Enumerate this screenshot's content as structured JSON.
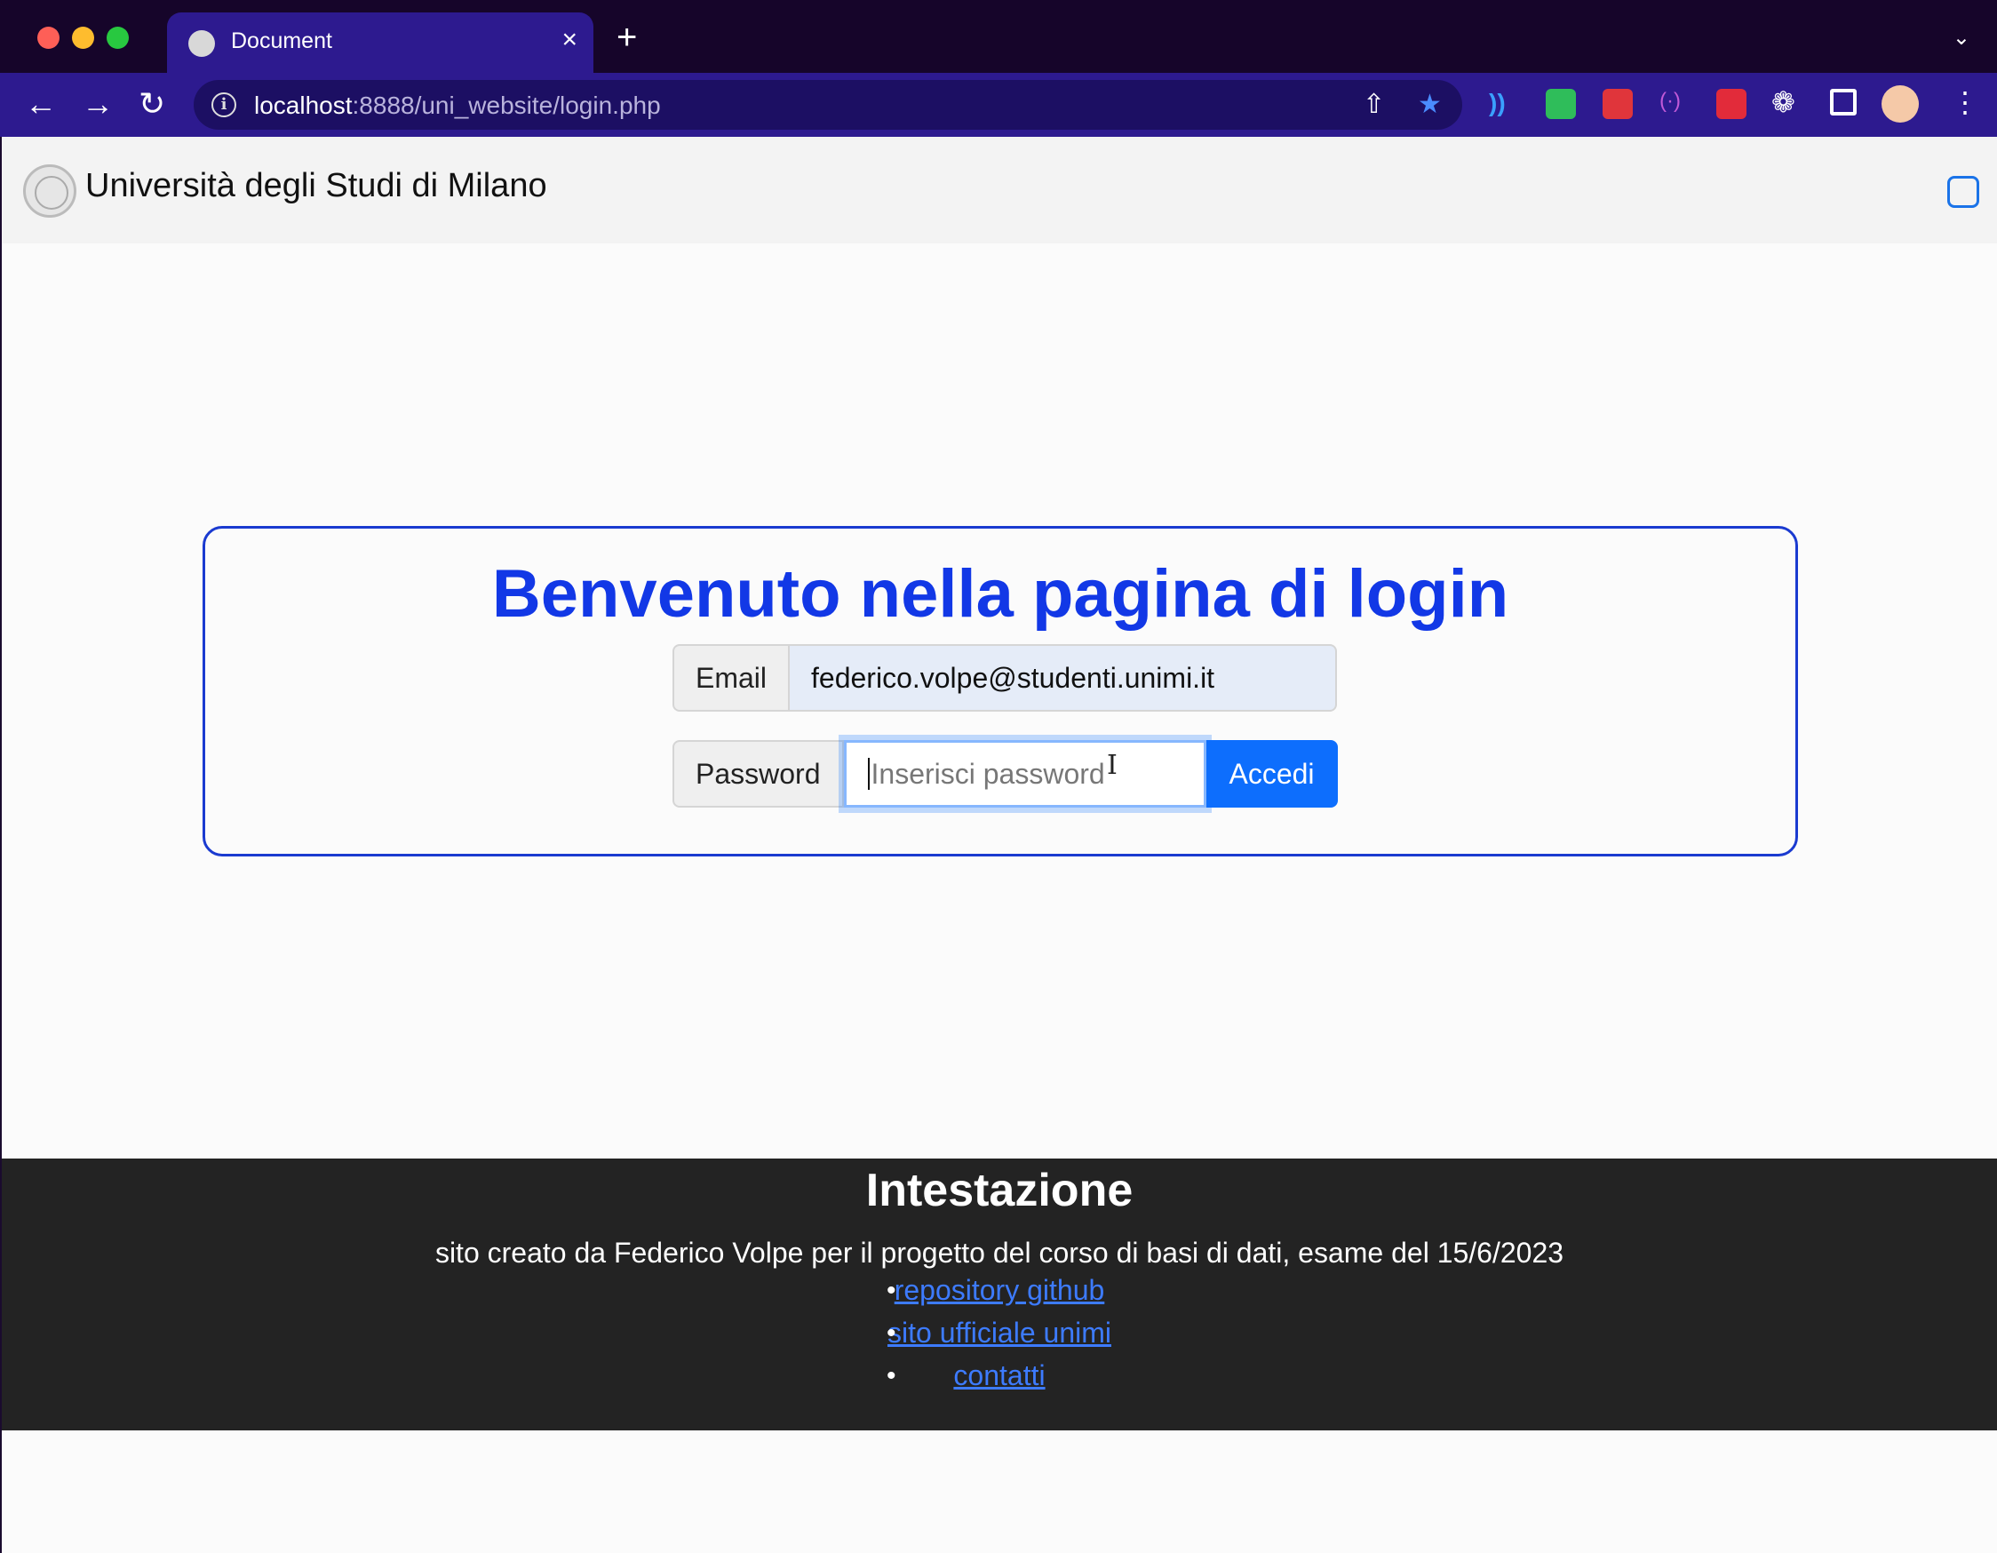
{
  "browser": {
    "tab_title": "Document",
    "url_host": "localhost",
    "url_rest": ":8888/uni_website/login.php",
    "new_tab": "+",
    "close": "×"
  },
  "navbar": {
    "brand": "Università degli Studi di Milano"
  },
  "login": {
    "heading": "Benvenuto nella pagina di login",
    "email_label": "Email",
    "email_value": "federico.volpe@studenti.unimi.it",
    "password_label": "Password",
    "password_placeholder": "Inserisci password",
    "submit_label": "Accedi"
  },
  "footer": {
    "title": "Intestazione",
    "description": "sito creato da Federico Volpe per il progetto del corso di basi di dati, esame del 15/6/2023",
    "links": [
      {
        "label": "repository github"
      },
      {
        "label": "sito ufficiale unimi"
      },
      {
        "label": "contatti"
      }
    ]
  },
  "colors": {
    "accent": "#1238e6",
    "primary_button": "#0d6efd",
    "footer_bg": "#232323"
  },
  "icons": [
    "back-icon",
    "forward-icon",
    "reload-icon",
    "info-icon",
    "share-icon",
    "star-icon",
    "extensions-icon",
    "sidepanel-icon",
    "menu-icon"
  ]
}
